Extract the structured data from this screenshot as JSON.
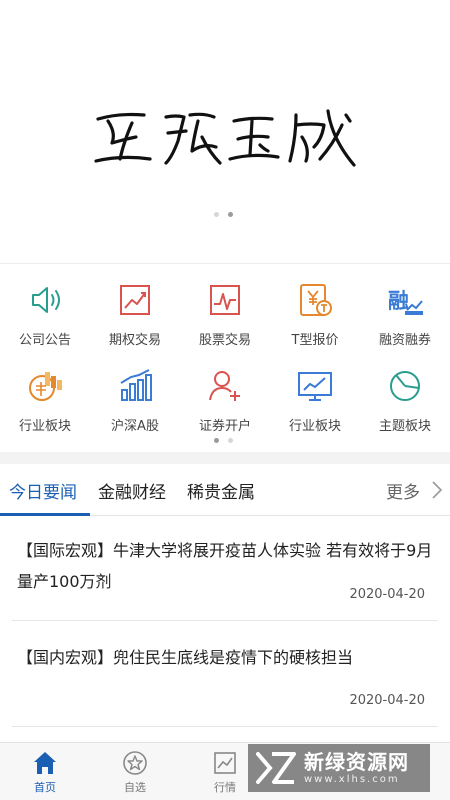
{
  "banner": {
    "calligraphy_text": "互联玉成"
  },
  "grid": {
    "items": [
      {
        "label": "公司公告",
        "icon": "announcement-speaker-icon"
      },
      {
        "label": "期权交易",
        "icon": "option-trading-chart-icon"
      },
      {
        "label": "股票交易",
        "icon": "stock-trading-chart-icon"
      },
      {
        "label": "T型报价",
        "icon": "t-quote-yen-icon"
      },
      {
        "label": "融资融券",
        "icon": "margin-financing-icon"
      },
      {
        "label": "行业板块",
        "icon": "industry-sector-coins-icon"
      },
      {
        "label": "沪深A股",
        "icon": "a-share-bars-icon"
      },
      {
        "label": "证券开户",
        "icon": "account-open-user-plus-icon"
      },
      {
        "label": "行业板块",
        "icon": "industry-monitor-icon"
      },
      {
        "label": "主题板块",
        "icon": "theme-pie-icon"
      }
    ]
  },
  "tabs": {
    "items": [
      "今日要闻",
      "金融财经",
      "稀贵金属"
    ],
    "more_label": "更多"
  },
  "news": [
    {
      "title": "【国际宏观】牛津大学将展开疫苗人体实验 若有效将于9月量产100万剂",
      "date": "2020-04-20"
    },
    {
      "title": "【国内宏观】兜住民生底线是疫情下的硬核担当",
      "date": "2020-04-20"
    }
  ],
  "bottom_nav": {
    "items": [
      {
        "label": "首页",
        "icon": "home-icon"
      },
      {
        "label": "自选",
        "icon": "star-circle-icon"
      },
      {
        "label": "行情",
        "icon": "market-chart-icon"
      }
    ]
  },
  "watermark": {
    "main": "新绿资源网",
    "sub": "www.xlhs.com"
  },
  "colors": {
    "accent": "#1a5fb4",
    "orange": "#e5882e",
    "red": "#d9534f",
    "teal": "#2a9d8f",
    "blue": "#3a7bd5"
  }
}
